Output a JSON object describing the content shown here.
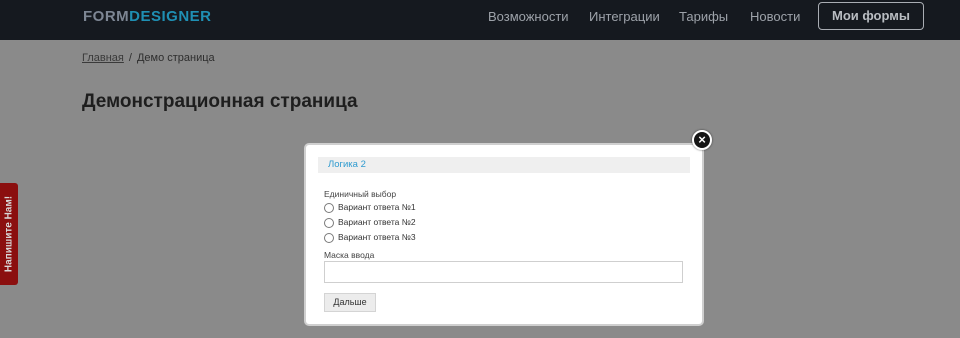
{
  "header": {
    "logo_part1": "FORM",
    "logo_part2": "DESIGNER",
    "nav": [
      "Возможности",
      "Интеграции",
      "Тарифы",
      "Новости"
    ],
    "my_forms_button": "Мои формы"
  },
  "breadcrumb": {
    "home": "Главная",
    "separator": "/",
    "current": "Демо страница"
  },
  "page_title": "Демонстрационная страница",
  "side_tab": "Напишите Нам!",
  "modal": {
    "close_symbol": "×",
    "section_title": "Логика 2",
    "single_choice_label": "Единичный выбор",
    "options": [
      "Вариант ответа №1",
      "Вариант ответа №2",
      "Вариант ответа №3"
    ],
    "input_mask_label": "Маска ввода",
    "input_mask_value": "",
    "next_button": "Дальше"
  },
  "colors": {
    "header_bg": "#15191f",
    "logo_accent": "#1f8fb3",
    "section_title": "#2f9bd0",
    "side_tab_bg": "#8b0f0f"
  }
}
